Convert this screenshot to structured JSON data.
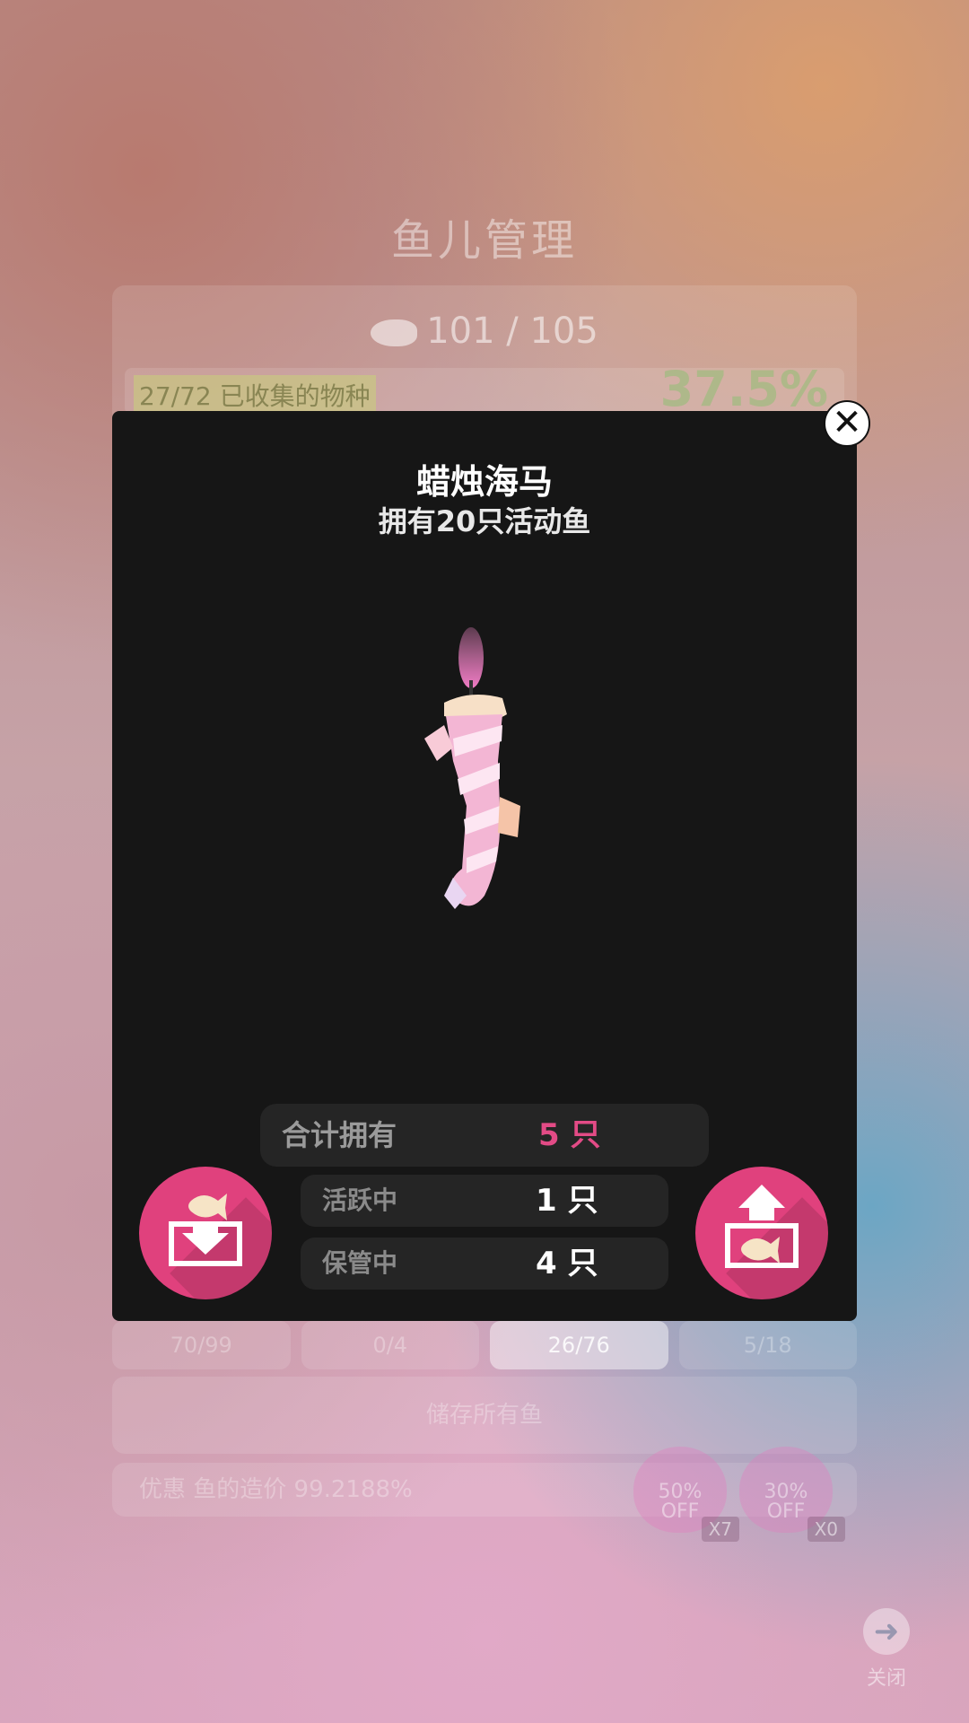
{
  "background": {
    "title": "鱼儿管理",
    "fish_count": "101 / 105",
    "collected_text": "27/72 已收集的物种",
    "collection_percent": "37.5%",
    "tabs": [
      {
        "label": "70/99"
      },
      {
        "label": "0/4"
      },
      {
        "label": "26/76"
      },
      {
        "label": "5/18"
      }
    ],
    "store_all_label": "储存所有鱼",
    "discount_text": "优惠 鱼的造价 99.2188%",
    "coupons": [
      {
        "label": "50%",
        "off": "OFF",
        "multiplier": "X7"
      },
      {
        "label": "30%",
        "off": "OFF",
        "multiplier": "X0"
      }
    ],
    "close_label": "关闭"
  },
  "modal": {
    "fish_name": "蜡烛海马",
    "subtitle": "拥有20只活动鱼",
    "total_label": "合计拥有",
    "total_value": "5 只",
    "active_label": "活跃中",
    "active_value": "1 只",
    "stored_label": "保管中",
    "stored_value": "4 只",
    "close_icon": "close-icon",
    "store_button_icon": "store-fish-icon",
    "retrieve_button_icon": "retrieve-fish-icon"
  },
  "colors": {
    "accent": "#e0417d",
    "value_pink": "#e34b86",
    "modal_bg": "#161616"
  }
}
